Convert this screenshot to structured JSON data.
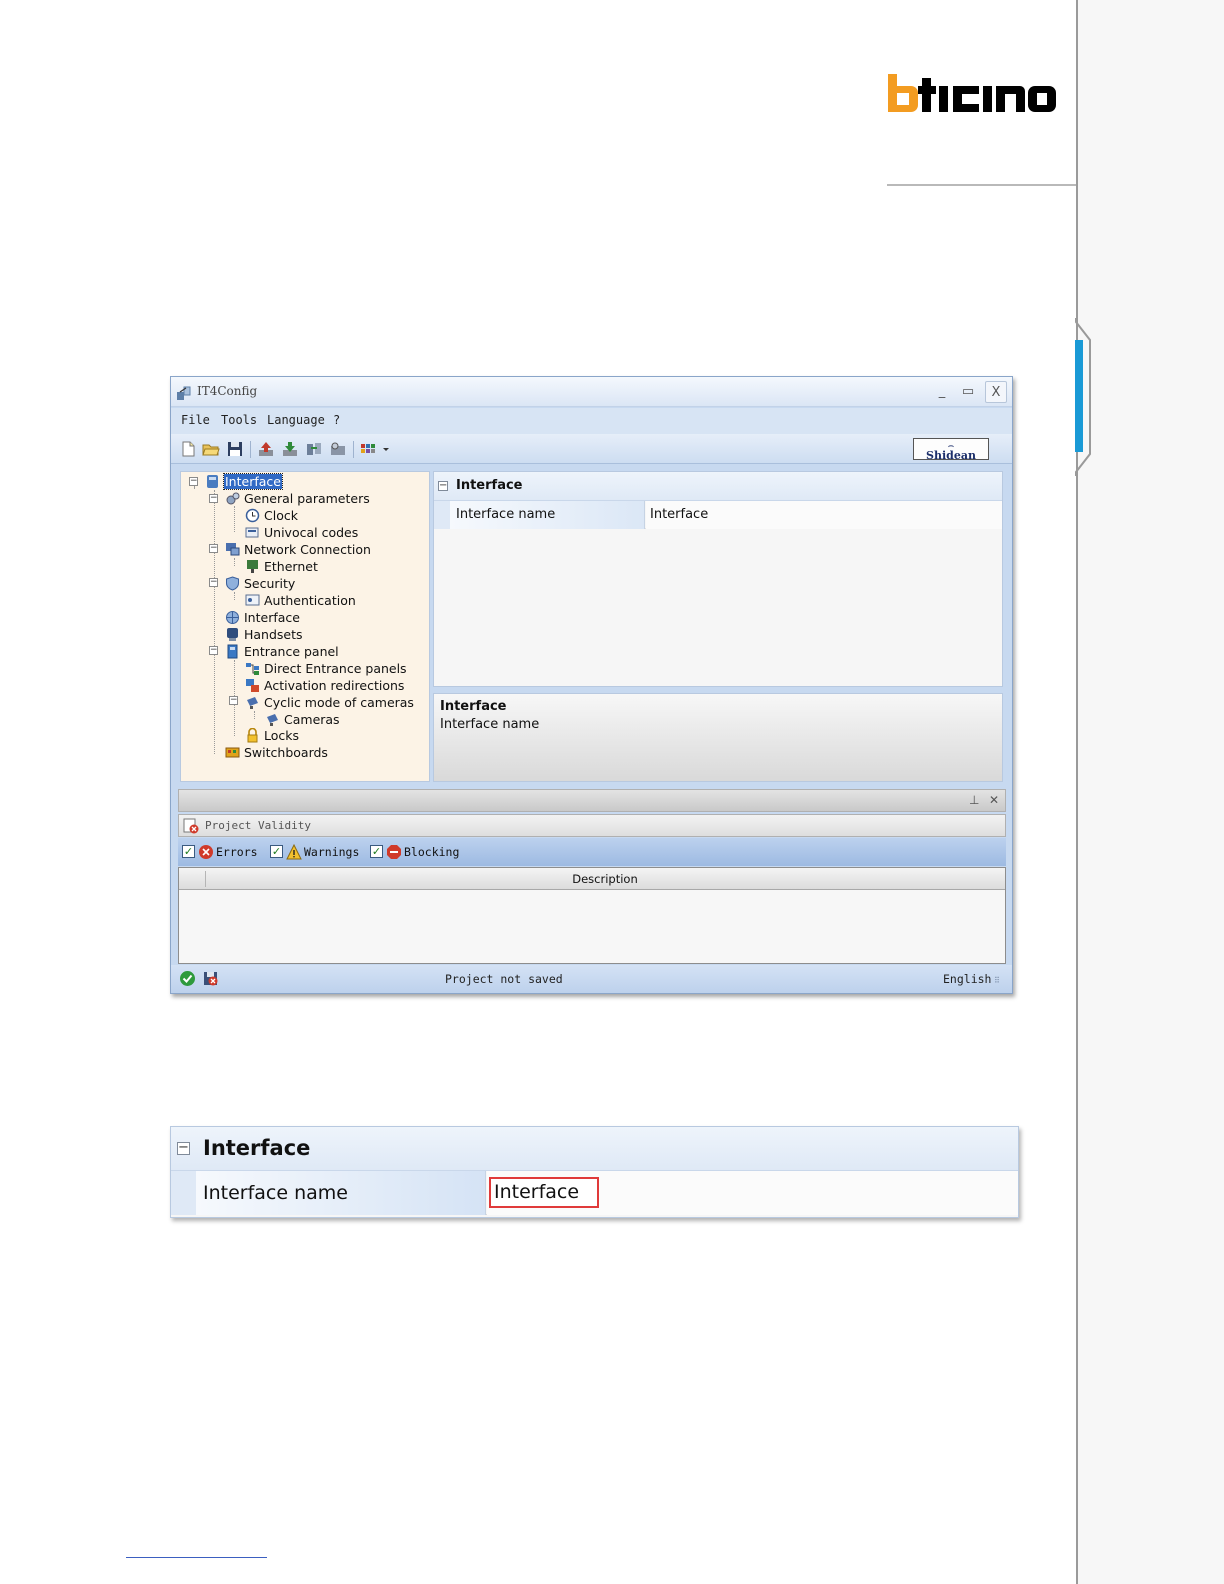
{
  "brand": {
    "logo_text": "bticino"
  },
  "app": {
    "window_title": "IT4Config",
    "window_controls": [
      "_",
      "▭",
      "X"
    ],
    "menu": [
      "File",
      "Tools",
      "Language",
      "?"
    ],
    "toolbar_brand_button": "Shidean",
    "tree": [
      {
        "label": "Interface",
        "level": 0,
        "icon": "interface-db-icon",
        "selected": true
      },
      {
        "label": "General parameters",
        "level": 1,
        "icon": "gears-icon"
      },
      {
        "label": "Clock",
        "level": 2,
        "icon": "clock-icon"
      },
      {
        "label": "Univocal codes",
        "level": 2,
        "icon": "codes-icon"
      },
      {
        "label": "Network Connection",
        "level": 1,
        "icon": "network-icon"
      },
      {
        "label": "Ethernet",
        "level": 2,
        "icon": "ethernet-icon"
      },
      {
        "label": "Security",
        "level": 1,
        "icon": "shield-icon"
      },
      {
        "label": "Authentication",
        "level": 2,
        "icon": "authentication-icon"
      },
      {
        "label": "Interface",
        "level": 1,
        "icon": "globe-icon"
      },
      {
        "label": "Handsets",
        "level": 1,
        "icon": "handset-icon"
      },
      {
        "label": "Entrance panel",
        "level": 1,
        "icon": "entrance-panel-icon"
      },
      {
        "label": "Direct Entrance panels",
        "level": 2,
        "icon": "direct-panels-icon"
      },
      {
        "label": "Activation redirections",
        "level": 2,
        "icon": "redirection-icon"
      },
      {
        "label": "Cyclic mode of cameras",
        "level": 2,
        "icon": "camera-icon"
      },
      {
        "label": "Cameras",
        "level": 3,
        "icon": "camera-icon"
      },
      {
        "label": "Locks",
        "level": 2,
        "icon": "lock-icon"
      },
      {
        "label": "Switchboards",
        "level": 1,
        "icon": "switchboard-icon"
      }
    ],
    "properties": {
      "category": "Interface",
      "rows": [
        {
          "name": "Interface name",
          "value": "Interface"
        }
      ]
    },
    "description": {
      "title": "Interface",
      "text": "Interface name"
    },
    "validity": {
      "dock_pin": "⊥",
      "dock_close": "✕",
      "tab_label": "Project Validity",
      "filters": [
        {
          "label": "Errors",
          "checked": true,
          "icon": "error-icon"
        },
        {
          "label": "Warnings",
          "checked": true,
          "icon": "warning-icon"
        },
        {
          "label": "Blocking",
          "checked": true,
          "icon": "stop-icon"
        }
      ],
      "column_header": "Description"
    },
    "status": {
      "text": "Project not saved",
      "language": "English"
    }
  },
  "zoom": {
    "category": "Interface",
    "property_name": "Interface name",
    "property_value": "Interface"
  },
  "colors": {
    "brand_orange": "#f39c21",
    "selection_blue": "#316ac5",
    "highlight_red": "#e03a3a"
  }
}
